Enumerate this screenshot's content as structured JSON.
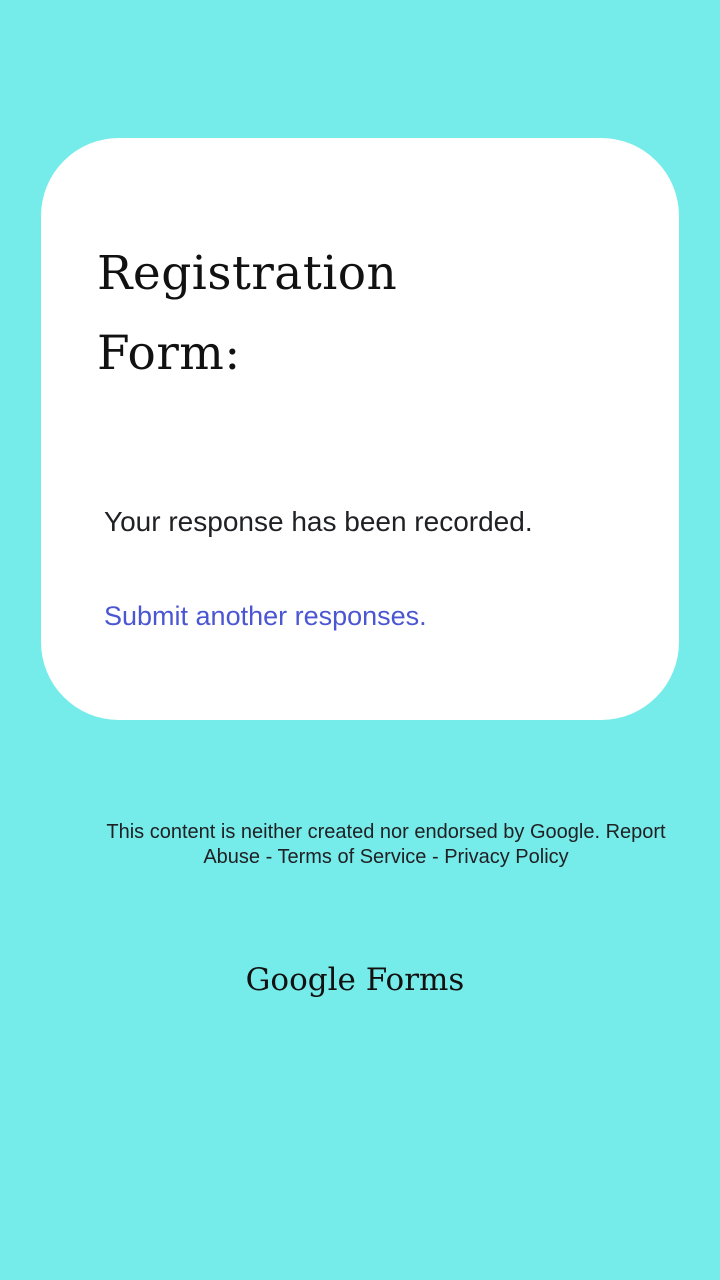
{
  "card": {
    "title": "Registration Form:",
    "confirmation": "Your response has been recorded.",
    "submit_another_link": "Submit another responses."
  },
  "footer": {
    "disclaimer": "This content is neither created nor endorsed by Google.",
    "report_abuse_link": "Report Abuse",
    "terms_link": "Terms of Service",
    "privacy_link": "Privacy Policy",
    "separator": " - ",
    "brand": "Google Forms"
  },
  "colors": {
    "background": "#76ecea",
    "card": "#ffffff",
    "link": "#4b56d2",
    "text": "#202124"
  }
}
